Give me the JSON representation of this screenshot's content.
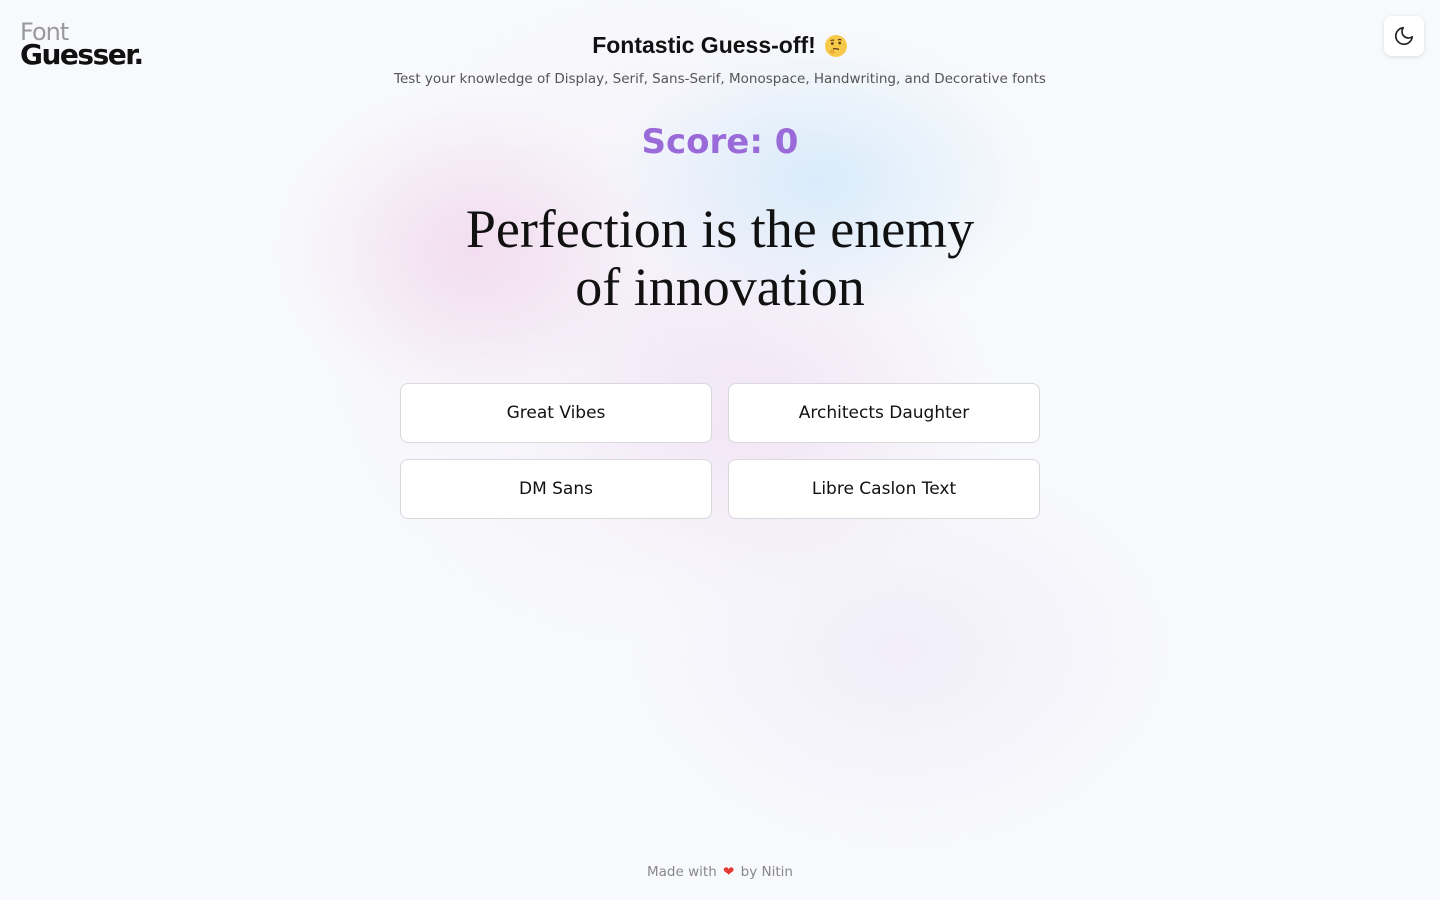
{
  "logo": {
    "top": "Font",
    "bottom": "Guesser."
  },
  "header": {
    "title": "Fontastic Guess-off!",
    "title_emoji": "thinking-face-icon",
    "subtitle": "Test your knowledge of Display, Serif, Sans-Serif, Monospace, Handwriting, and Decorative fonts"
  },
  "score": {
    "label": "Score:",
    "value": "0"
  },
  "quote": {
    "line1": "Perfection is the enemy",
    "line2": "of innovation"
  },
  "options": [
    "Great Vibes",
    "Architects Daughter",
    "DM Sans",
    "Libre Caslon Text"
  ],
  "footer": {
    "made_with": "Made with",
    "heart": "❤",
    "by": "by Nitin"
  },
  "theme_toggle_icon": "moon-icon",
  "colors": {
    "accent": "#9a6ad9",
    "heart": "#e53935"
  }
}
